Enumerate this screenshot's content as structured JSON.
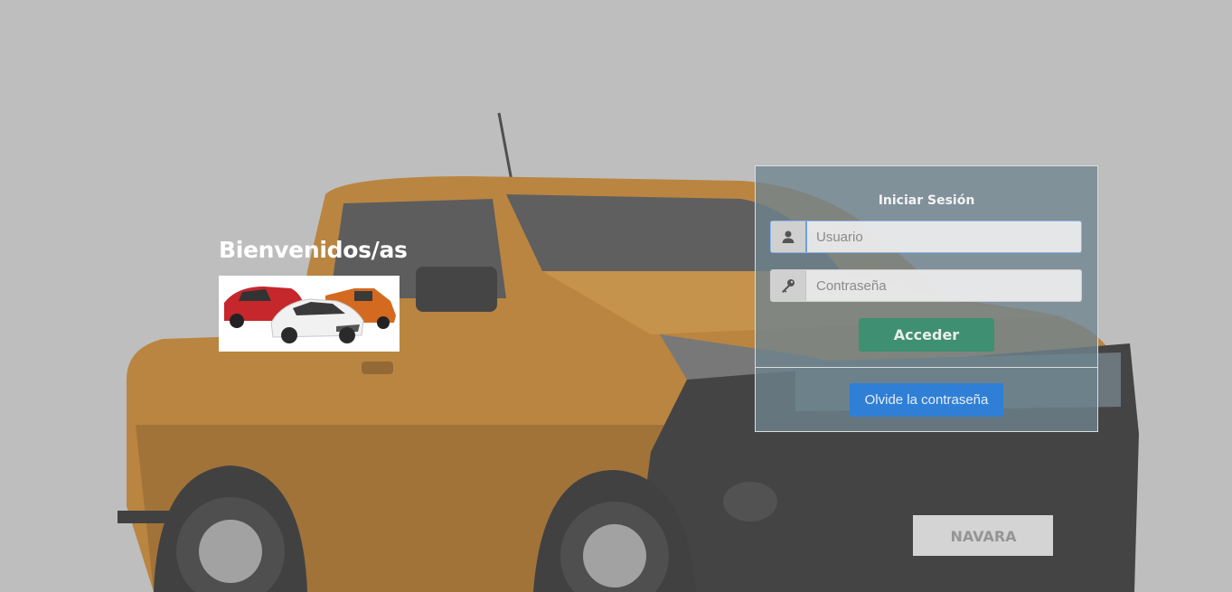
{
  "welcome": {
    "heading": "Bienvenidos/as"
  },
  "login": {
    "title": "Iniciar Sesión",
    "username": {
      "placeholder": "Usuario",
      "value": "",
      "icon": "user-icon"
    },
    "password": {
      "placeholder": "Contraseña",
      "value": "",
      "icon": "key-icon"
    },
    "submit_label": "Acceder",
    "forgot_label": "Olvide la contraseña"
  },
  "background": {
    "truck_plate": "NAVARA"
  },
  "colors": {
    "top_bar": "#2f6b2f",
    "truck_body": "#b87a2a",
    "submit_button": "#3f8f73",
    "forgot_button": "#2f7fd6",
    "login_panel": "#6e8490"
  }
}
